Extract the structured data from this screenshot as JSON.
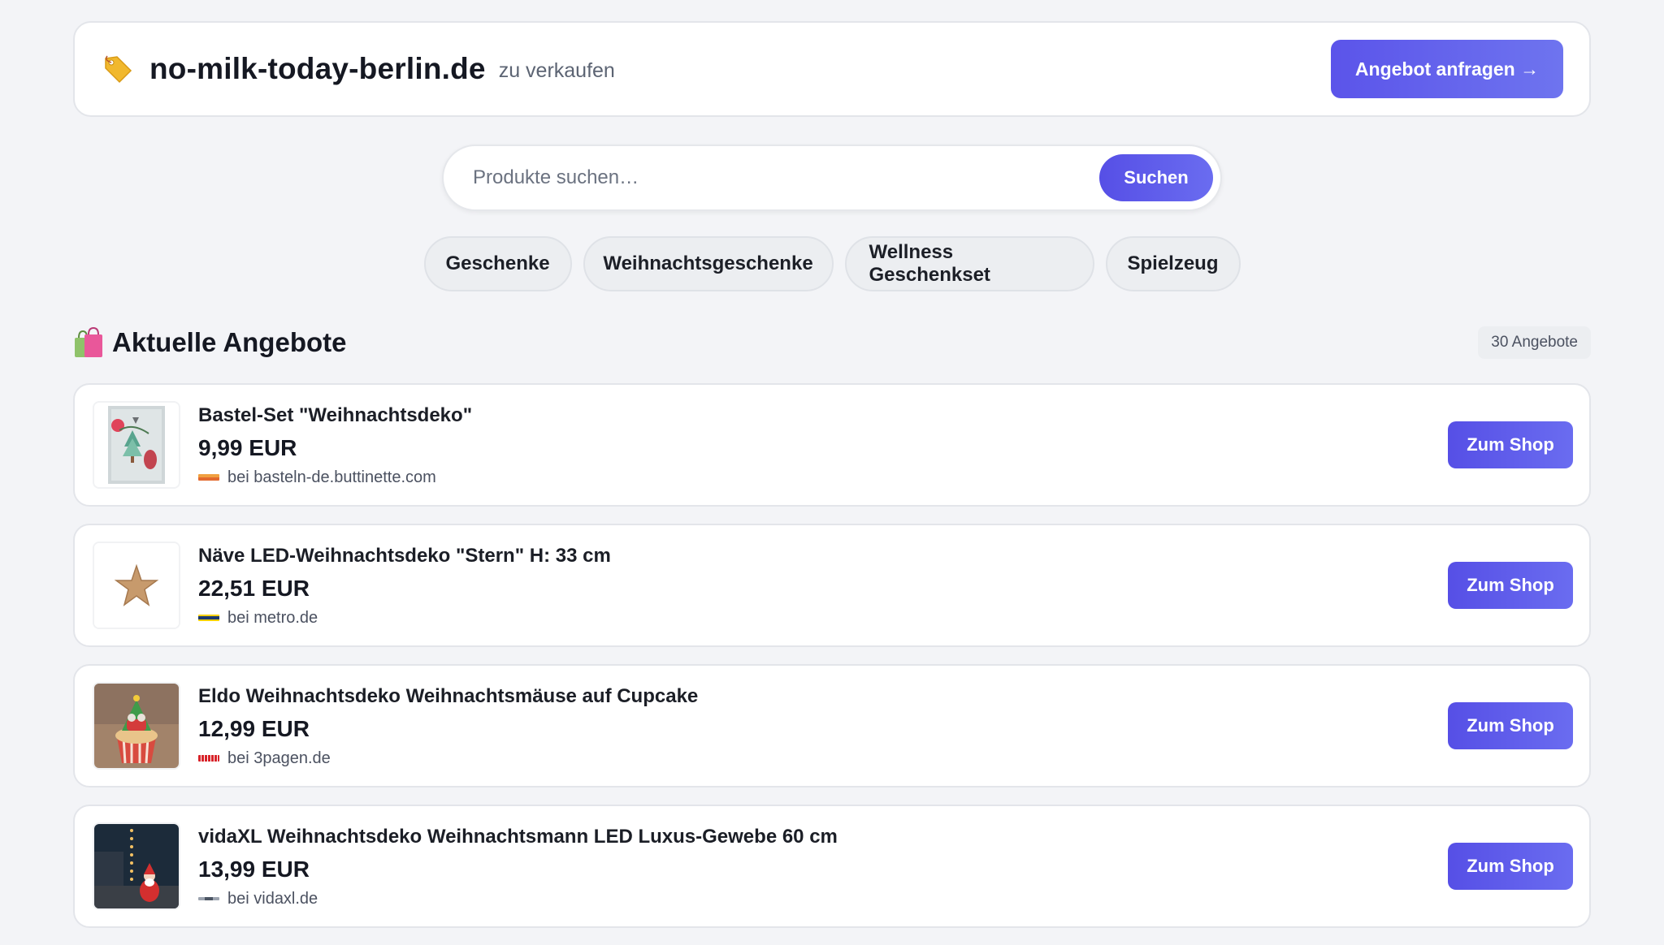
{
  "header": {
    "domain": "no-milk-today-berlin.de",
    "sale_label": "zu verkaufen",
    "offer_button": "Angebot anfragen →",
    "icon": "price-tag-icon"
  },
  "search": {
    "placeholder": "Produkte suchen…",
    "value": "",
    "button": "Suchen"
  },
  "categories": [
    "Geschenke",
    "Weihnachtsgeschenke",
    "Wellness Geschenkset",
    "Spielzeug"
  ],
  "section": {
    "title": "Aktuelle Angebote",
    "icon": "shopping-bags-icon",
    "count": "30 Angebote"
  },
  "products": [
    {
      "title": "Bastel-Set \"Weihnachtsdeko\"",
      "price": "9,99 EUR",
      "shop": "bei basteln-de.buttinette.com",
      "button": "Zum Shop"
    },
    {
      "title": "Näve LED-Weihnachtsdeko \"Stern\" H: 33 cm",
      "price": "22,51 EUR",
      "shop": "bei metro.de",
      "button": "Zum Shop"
    },
    {
      "title": "Eldo Weihnachtsdeko Weihnachtsmäuse auf Cupcake",
      "price": "12,99 EUR",
      "shop": "bei 3pagen.de",
      "button": "Zum Shop"
    },
    {
      "title": "vidaXL Weihnachtsdeko Weihnachtsmann LED Luxus-Gewebe 60 cm",
      "price": "13,99 EUR",
      "shop": "bei vidaxl.de",
      "button": "Zum Shop"
    }
  ],
  "colors": {
    "accent": "#5b54ea",
    "accent_light": "#6e74ef",
    "background": "#f3f4f7"
  }
}
